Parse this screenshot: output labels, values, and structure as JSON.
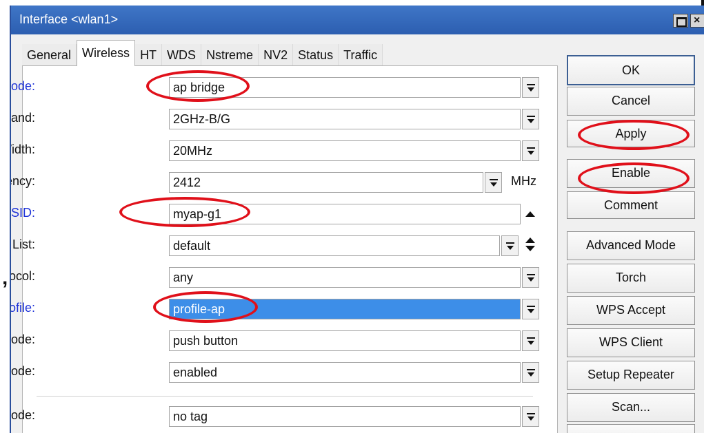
{
  "window": {
    "title": "Interface <wlan1>"
  },
  "tabs": [
    {
      "label": "General",
      "active": false
    },
    {
      "label": "Wireless",
      "active": true
    },
    {
      "label": "HT",
      "active": false
    },
    {
      "label": "WDS",
      "active": false
    },
    {
      "label": "Nstreme",
      "active": false
    },
    {
      "label": "NV2",
      "active": false
    },
    {
      "label": "Status",
      "active": false
    },
    {
      "label": "Traffic",
      "active": false
    }
  ],
  "fields": {
    "mode": {
      "label": "Mode:",
      "value": "ap bridge"
    },
    "band": {
      "label": "Band:",
      "value": "2GHz-B/G"
    },
    "channel_width": {
      "label": "Channel Width:",
      "value": "20MHz"
    },
    "frequency": {
      "label": "Frequency:",
      "value": "2412",
      "unit": "MHz"
    },
    "ssid": {
      "label": "SSID:",
      "value": "myap-g1"
    },
    "scan_list": {
      "label": "Scan List:",
      "value": "default"
    },
    "wireless_protocol": {
      "label": "Wireless Protocol:",
      "value": "any"
    },
    "security_profile": {
      "label": "Security Profile:",
      "value": "profile-ap"
    },
    "wps_mode": {
      "label": "WPS Mode:",
      "value": "push button"
    },
    "bridge_mode": {
      "label": "Bridge Mode:",
      "value": "enabled"
    },
    "vlan_mode": {
      "label": "VLAN Mode:",
      "value": "no tag"
    }
  },
  "actions": {
    "ok": "OK",
    "cancel": "Cancel",
    "apply": "Apply",
    "enable": "Enable",
    "comment": "Comment",
    "advanced_mode": "Advanced Mode",
    "torch": "Torch",
    "wps_accept": "WPS Accept",
    "wps_client": "WPS Client",
    "setup_repeater": "Setup Repeater",
    "scan": "Scan..."
  },
  "colors": {
    "titlebar": "#3a6fc2",
    "highlight_label": "#1e33d8",
    "selection": "#3d8ee8",
    "annotation_ring": "#e0101a"
  },
  "icons": {
    "maximize": "maximize-icon",
    "close": "close-icon",
    "dropdown": "dropdown-arrow-icon"
  }
}
